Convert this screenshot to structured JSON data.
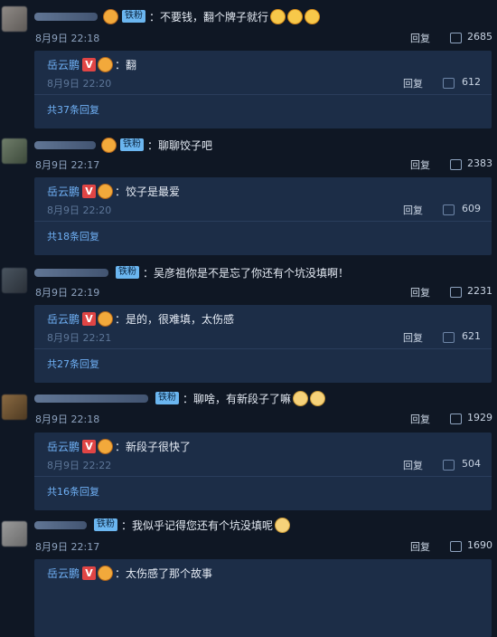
{
  "labels": {
    "reply": "回复",
    "badge": "铁粉",
    "vip": "V"
  },
  "threads": [
    {
      "text": "：不要钱，翻个牌子就行",
      "time": "8月9日 22:18",
      "likes": "2685",
      "sub_author": "岳云鹏",
      "sub_text": "：翻",
      "sub_time": "8月9日 22:20",
      "sub_likes": "612",
      "total": "共37条回复"
    },
    {
      "text": "：聊聊饺子吧",
      "time": "8月9日 22:17",
      "likes": "2383",
      "sub_author": "岳云鹏",
      "sub_text": "：饺子是最爱",
      "sub_time": "8月9日 22:20",
      "sub_likes": "609",
      "total": "共18条回复"
    },
    {
      "text": "：吴彦祖你是不是忘了你还有个坑没填啊！",
      "time": "8月9日 22:19",
      "likes": "2231",
      "sub_author": "岳云鹏",
      "sub_text": "：是的，很难填，太伤感",
      "sub_time": "8月9日 22:21",
      "sub_likes": "621",
      "total": "共27条回复"
    },
    {
      "text": "：聊啥，有新段子了嘛",
      "time": "8月9日 22:18",
      "likes": "1929",
      "sub_author": "岳云鹏",
      "sub_text": "：新段子很快了",
      "sub_time": "8月9日 22:22",
      "sub_likes": "504",
      "total": "共16条回复"
    },
    {
      "text": "：我似乎记得您还有个坑没填呢",
      "time": "8月9日 22:17",
      "likes": "1690",
      "sub_author": "岳云鹏",
      "sub_text": "：太伤感了那个故事",
      "sub_time": "",
      "sub_likes": "",
      "total": ""
    }
  ]
}
